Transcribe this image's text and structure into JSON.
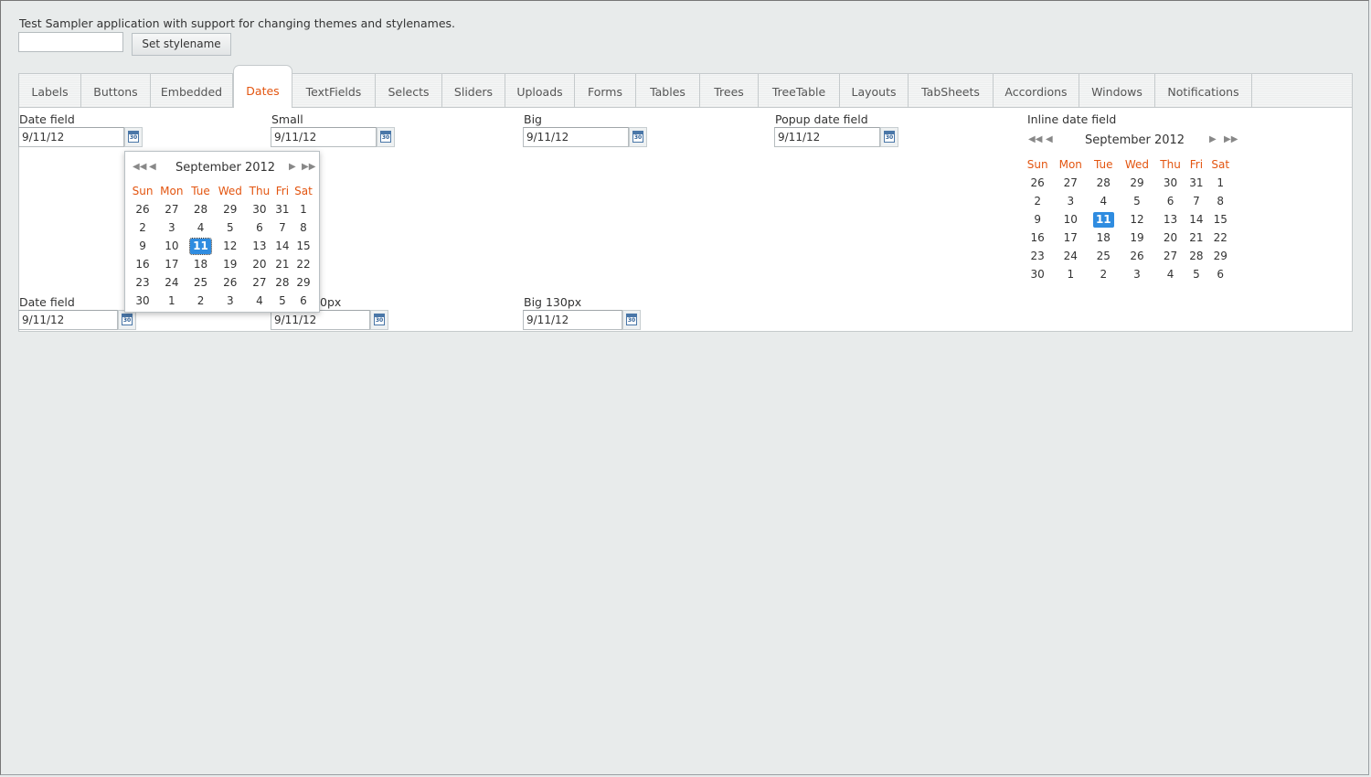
{
  "header": {
    "title": "Test Sampler application with support for changing themes and stylenames.",
    "stylename_value": "",
    "set_stylename": "Set stylename"
  },
  "tabs": [
    {
      "label": "Labels"
    },
    {
      "label": "Buttons"
    },
    {
      "label": "Embedded"
    },
    {
      "label": "Dates"
    },
    {
      "label": "TextFields"
    },
    {
      "label": "Selects"
    },
    {
      "label": "Sliders"
    },
    {
      "label": "Uploads"
    },
    {
      "label": "Forms"
    },
    {
      "label": "Tables"
    },
    {
      "label": "Trees"
    },
    {
      "label": "TreeTable"
    },
    {
      "label": "Layouts"
    },
    {
      "label": "TabSheets"
    },
    {
      "label": "Accordions"
    },
    {
      "label": "Windows"
    },
    {
      "label": "Notifications"
    }
  ],
  "selected_tab": "Dates",
  "fields": {
    "date_field": {
      "label": "Date field",
      "value": "9/11/12"
    },
    "small": {
      "label": "Small",
      "value": "9/11/12"
    },
    "big": {
      "label": "Big",
      "value": "9/11/12"
    },
    "popup_date_field": {
      "label": "Popup date field",
      "value": "9/11/12"
    },
    "inline_date_field": {
      "label": "Inline date field"
    },
    "date_field_2": {
      "label": "Date field",
      "value": "9/11/12"
    },
    "small_130": {
      "label": "0px",
      "value": "9/11/12"
    },
    "big_130": {
      "label": "Big 130px",
      "value": "9/11/12"
    }
  },
  "calendar_icon_text": "30",
  "calendar": {
    "month": "September 2012",
    "weekdays": [
      "Sun",
      "Mon",
      "Tue",
      "Wed",
      "Thu",
      "Fri",
      "Sat"
    ],
    "weeks": [
      [
        "26",
        "27",
        "28",
        "29",
        "30",
        "31",
        "1"
      ],
      [
        "2",
        "3",
        "4",
        "5",
        "6",
        "7",
        "8"
      ],
      [
        "9",
        "10",
        "11",
        "12",
        "13",
        "14",
        "15"
      ],
      [
        "16",
        "17",
        "18",
        "19",
        "20",
        "21",
        "22"
      ],
      [
        "23",
        "24",
        "25",
        "26",
        "27",
        "28",
        "29"
      ],
      [
        "30",
        "1",
        "2",
        "3",
        "4",
        "5",
        "6"
      ]
    ],
    "selected_day": "11",
    "nav": {
      "prev_year": "◀◀",
      "prev_month": "◀",
      "next_month": "▶",
      "next_year": "▶▶"
    }
  },
  "colors": {
    "accent": "#e35510",
    "selected_day": "#2f8ce0"
  }
}
